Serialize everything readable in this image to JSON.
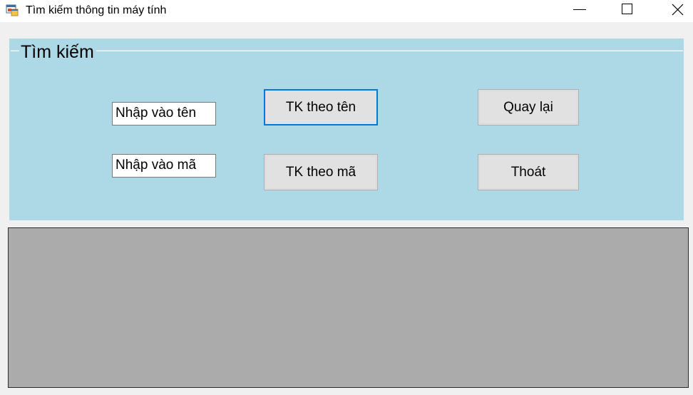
{
  "window": {
    "title": "Tìm kiếm thông tin máy tính",
    "icon": "windows-form-icon",
    "controls": [
      "minimize-icon",
      "maximize-icon",
      "close-icon"
    ]
  },
  "search_group": {
    "title": "Tìm kiếm",
    "name_input": {
      "value": "Nhập vào tên"
    },
    "code_input": {
      "value": "Nhập vào mã"
    },
    "buttons": {
      "search_by_name": "TK theo tên",
      "search_by_code": "TK theo mã",
      "back": "Quay lại",
      "exit": "Thoát"
    }
  },
  "results_grid": {
    "rows": []
  },
  "colors": {
    "group_background": "#add8e6",
    "grid_background": "#ababab",
    "focus_border": "#0078d7",
    "button_face": "#e1e1e1"
  }
}
